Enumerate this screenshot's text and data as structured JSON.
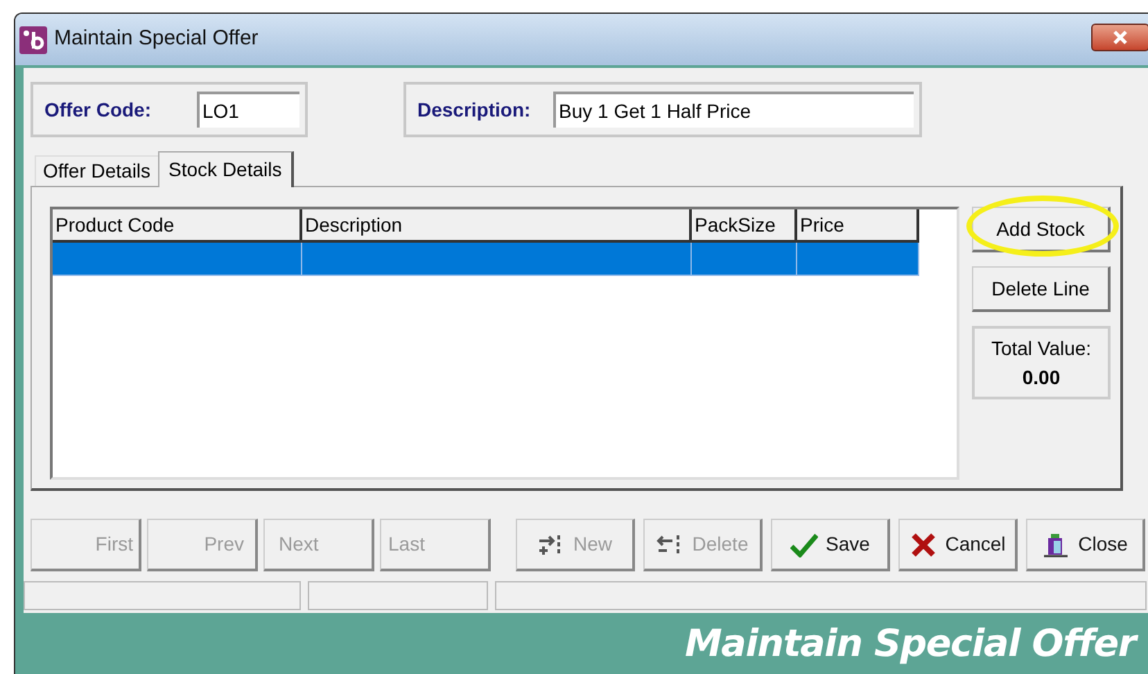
{
  "window": {
    "title": "Maintain Special Offer"
  },
  "offer_code": {
    "label": "Offer Code:",
    "value": "LO1"
  },
  "description": {
    "label": "Description:",
    "value": "Buy 1 Get 1 Half Price"
  },
  "tabs": [
    {
      "label": "Offer Details",
      "selected": false
    },
    {
      "label": "Stock Details",
      "selected": true
    }
  ],
  "table": {
    "columns": [
      "Product Code",
      "Description",
      "PackSize",
      "Price"
    ],
    "rows": [
      {
        "selected": true
      }
    ]
  },
  "side_buttons": [
    {
      "label": "Add Stock",
      "highlighted": true
    },
    {
      "label": "Delete Line",
      "highlighted": false
    }
  ],
  "total": {
    "label": "Total Value:",
    "value": "0.00"
  },
  "nav_buttons": [
    {
      "label": "First",
      "disabled": true
    },
    {
      "label": "Prev",
      "disabled": true
    },
    {
      "label": "Next",
      "disabled": true
    },
    {
      "label": "Last",
      "disabled": true
    }
  ],
  "action_buttons": [
    {
      "label": "New",
      "kind": "new",
      "disabled": true
    },
    {
      "label": "Delete",
      "kind": "delete",
      "disabled": true
    },
    {
      "label": "Save",
      "kind": "save",
      "disabled": false
    },
    {
      "label": "Cancel",
      "kind": "cancel",
      "disabled": false
    },
    {
      "label": "Close",
      "kind": "close",
      "disabled": false
    }
  ],
  "banner": "Maintain Special Offer"
}
